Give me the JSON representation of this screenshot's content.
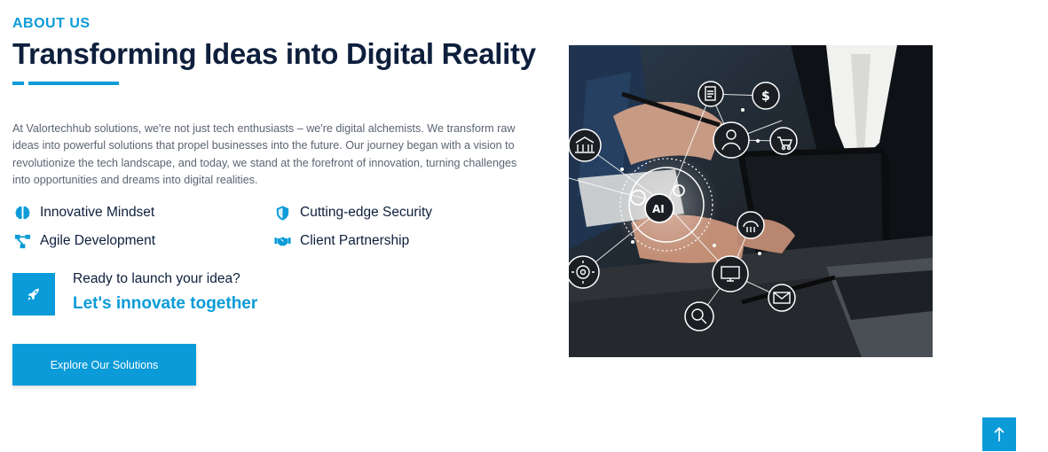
{
  "section": {
    "eyebrow": "ABOUT US",
    "title": "Transforming Ideas into Digital Reality",
    "description": "At Valortechhub solutions, we're not just tech enthusiasts – we're digital alchemists. We transform raw ideas into powerful solutions that propel businesses into the future. Our journey began with a vision to revolutionize the tech landscape, and today, we stand at the forefront of innovation, turning challenges into opportunities and dreams into digital realities."
  },
  "features": [
    {
      "label": "Innovative Mindset",
      "icon": "brain-icon"
    },
    {
      "label": "Agile Development",
      "icon": "workflow-icon"
    },
    {
      "label": "Cutting-edge Security",
      "icon": "shield-icon"
    },
    {
      "label": "Client Partnership",
      "icon": "handshake-icon"
    }
  ],
  "cta": {
    "icon": "rocket-icon",
    "question": "Ready to launch your idea?",
    "link": "Let's innovate together"
  },
  "button": {
    "label": "Explore Our Solutions"
  },
  "hero_image": {
    "alt": "Business people with digital technology network icons around AI"
  },
  "scroll_top": {
    "icon": "arrow-up-icon"
  },
  "colors": {
    "accent": "#0a9bd8",
    "heading": "#0d1f3c",
    "body_text": "#5b6472"
  }
}
